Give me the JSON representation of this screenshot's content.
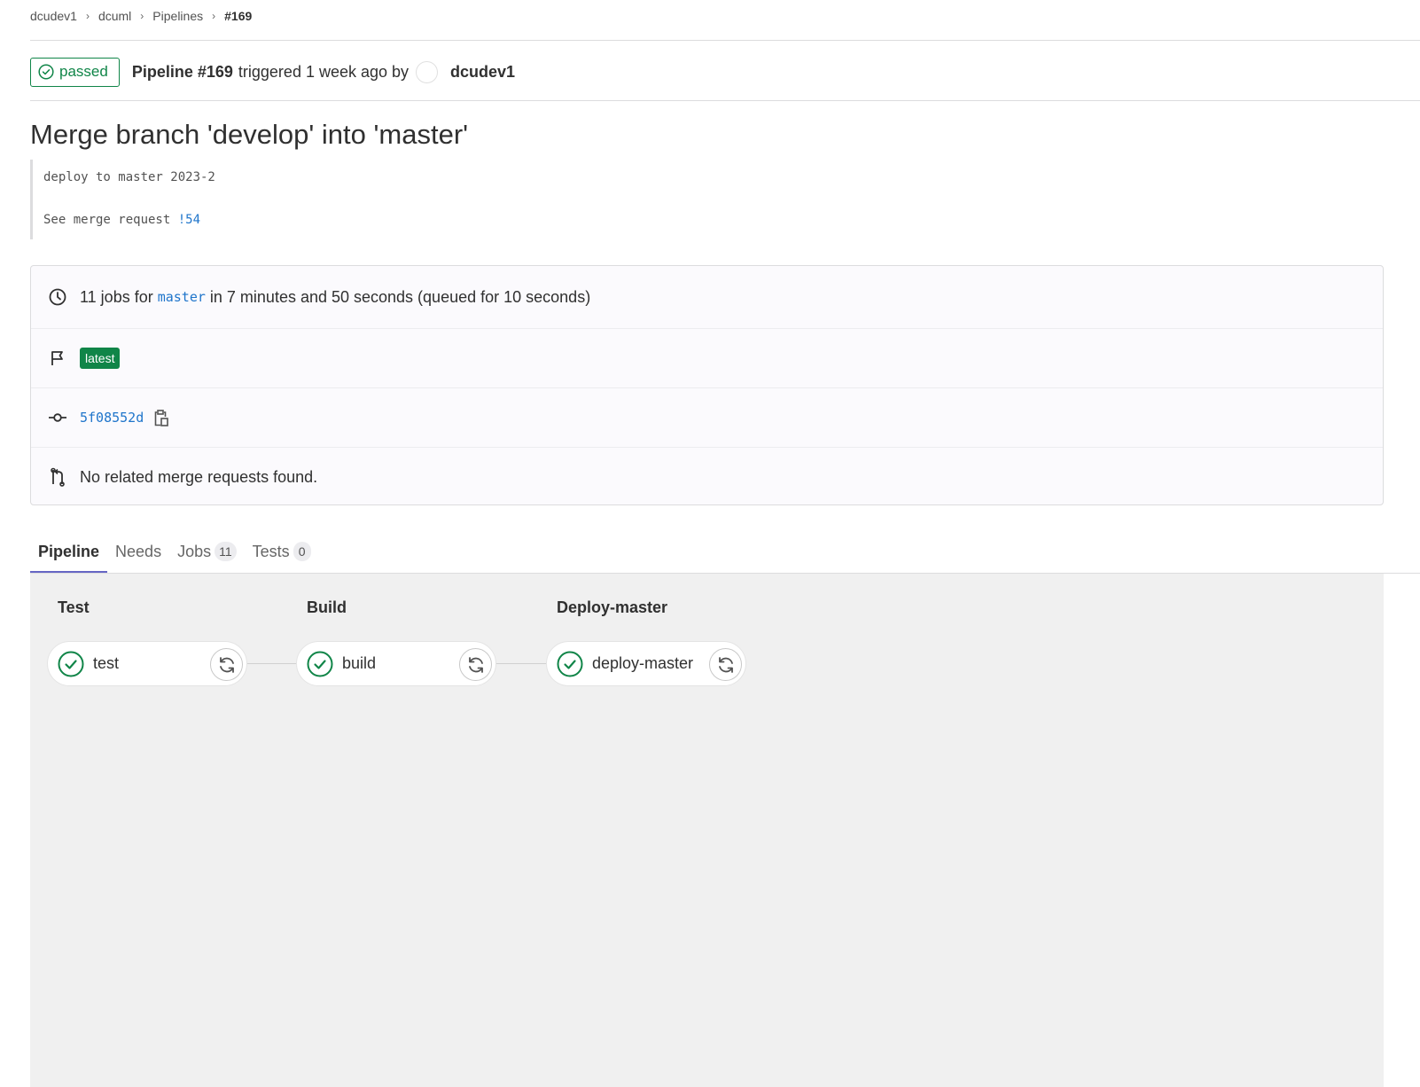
{
  "breadcrumb": {
    "items": [
      "dcudev1",
      "dcuml",
      "Pipelines",
      "#169"
    ]
  },
  "header": {
    "status": "passed",
    "pipeline_label": "Pipeline #169",
    "triggered_text": "triggered 1 week ago by",
    "author": "dcudev1"
  },
  "commit": {
    "title": "Merge branch 'develop' into 'master'",
    "description_line1": "deploy to master 2023-2",
    "description_line2_prefix": "See merge request",
    "merge_request_ref": "!54"
  },
  "info": {
    "jobs_prefix": "11 jobs for",
    "branch": "master",
    "jobs_suffix": "in 7 minutes and 50 seconds (queued for 10 seconds)",
    "badge": "latest",
    "sha": "5f08552d",
    "related_mr": "No related merge requests found."
  },
  "tabs": [
    {
      "label": "Pipeline",
      "count": null
    },
    {
      "label": "Needs",
      "count": null
    },
    {
      "label": "Jobs",
      "count": "11"
    },
    {
      "label": "Tests",
      "count": "0"
    }
  ],
  "stages": [
    {
      "title": "Test",
      "job": "test",
      "status": "success"
    },
    {
      "title": "Build",
      "job": "build",
      "status": "success"
    },
    {
      "title": "Deploy-master",
      "job": "deploy-master",
      "status": "success"
    }
  ],
  "colors": {
    "success": "#108548",
    "link": "#1f75cb",
    "tab_indicator": "#6666c4",
    "graph_background": "#f0f0f0"
  }
}
